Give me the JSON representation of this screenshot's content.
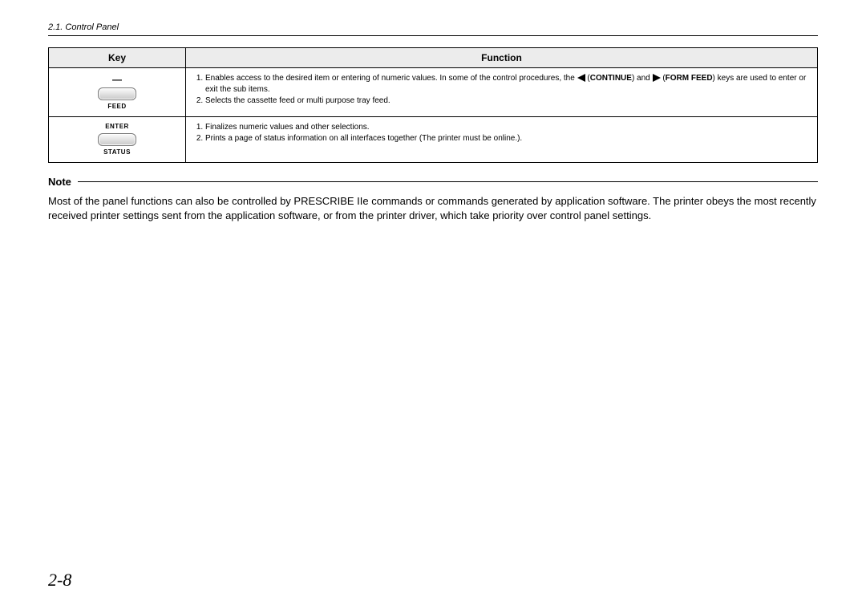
{
  "header": {
    "running_title": "2.1. Control Panel"
  },
  "table": {
    "headers": {
      "key": "Key",
      "function": "Function"
    },
    "rows": [
      {
        "key": {
          "top_symbol": "—",
          "label_below_button": "FEED"
        },
        "function": {
          "item1_pre": "Enables access to the desired item or entering of numeric values. In some of the control procedures, the ",
          "item1_cont_label": "CONTINUE",
          "item1_mid": ") and ",
          "item1_ff_label": "FORM FEED",
          "item1_post": ") keys are used to enter or exit the sub items.",
          "item2": "Selects the cassette feed or multi purpose tray feed."
        }
      },
      {
        "key": {
          "top_label": "ENTER",
          "label_below_button": "STATUS"
        },
        "function": {
          "item1": "Finalizes numeric values and other selections.",
          "item2": "Prints a page of status information on all interfaces together (The printer must be online.)."
        }
      }
    ]
  },
  "note": {
    "label": "Note",
    "body": "Most of the panel functions can also be controlled by PRESCRIBE IIe commands or commands generated by application software. The printer obeys the most recently received printer settings sent from the application software, or from the printer driver, which take priority over control panel settings."
  },
  "page_number": "2-8"
}
